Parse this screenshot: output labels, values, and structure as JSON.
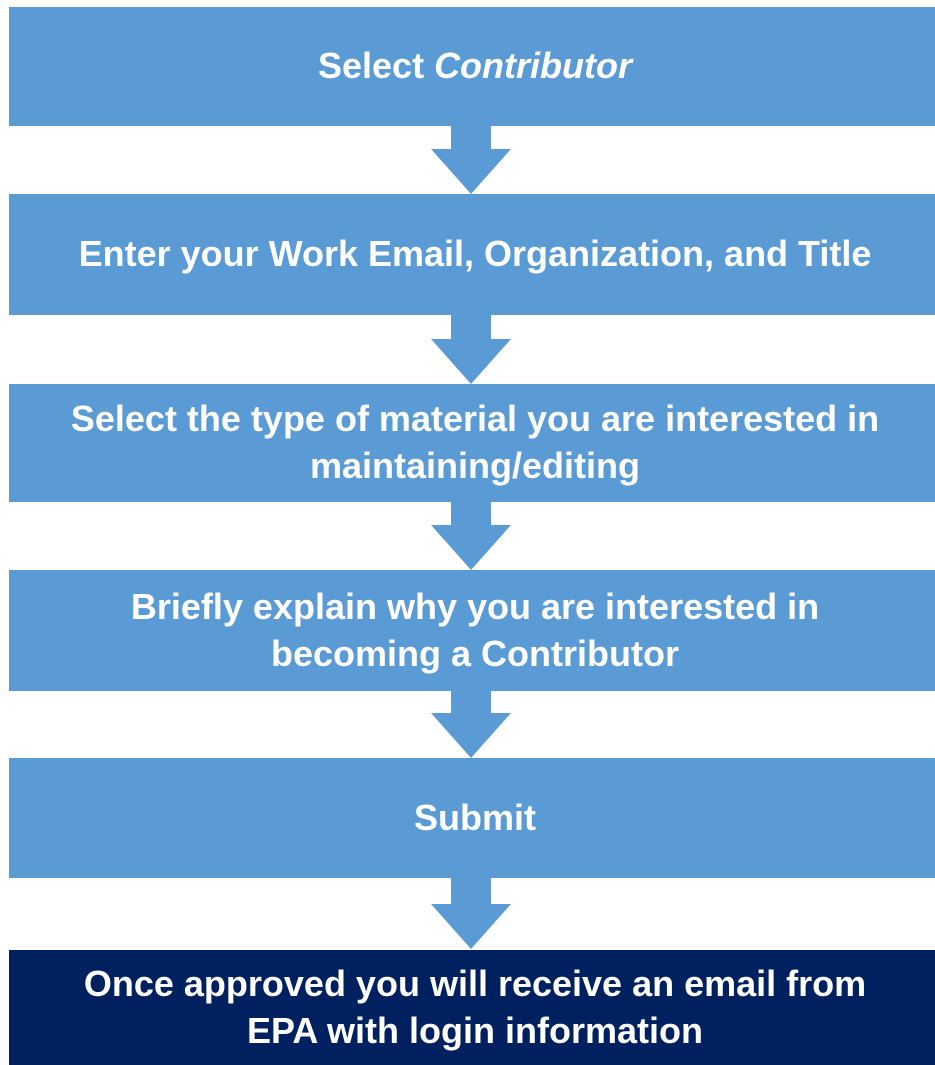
{
  "steps": [
    {
      "text": "Select ",
      "italic": "Contributor"
    },
    {
      "text": "Enter your Work Email, Organization, and Title"
    },
    {
      "text": "Select the type of material you are interested in maintaining/editing"
    },
    {
      "text": "Briefly explain why you are interested in becoming a Contributor"
    },
    {
      "text": "Submit"
    },
    {
      "text": "Once approved you will receive an email from EPA with login information"
    }
  ],
  "colors": {
    "step_fill": "#5b9bd5",
    "final_fill": "#002060",
    "text": "#ffffff"
  }
}
